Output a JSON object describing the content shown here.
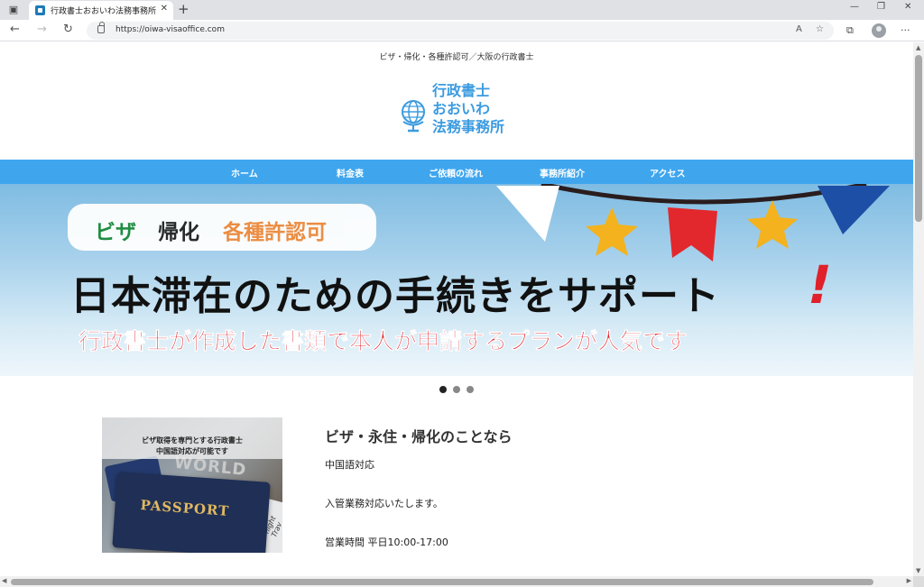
{
  "browser": {
    "tab_title": "行政書士おおいわ法務事務所",
    "url": "https://oiwa-visaoffice.com",
    "icons": {
      "window_menu": "window-icon",
      "new_tab": "plus-icon",
      "back": "back-arrow-icon",
      "forward": "forward-arrow-icon",
      "reload": "reload-icon",
      "lock": "lock-icon",
      "read_aloud": "read-aloud-icon",
      "favorites_add": "star-add-icon",
      "collections": "collections-icon",
      "profile": "profile-icon",
      "more": "more-icon"
    }
  },
  "site": {
    "tagline": "ビザ・帰化・各種許認可／大阪の行政書士",
    "logo_lines": [
      "行政書士",
      "おおいわ",
      "法務事務所"
    ],
    "logo_color": "#3b9be0",
    "nav": [
      "ホーム",
      "料金表",
      "ご依頼の流れ",
      "事務所紹介",
      "アクセス"
    ],
    "nav_color": "#3fa6ee"
  },
  "hero": {
    "pill_visa": "ビザ",
    "pill_naturalization": "帰化",
    "pill_permits": "各種許認可",
    "main_text": "日本滞在のための手続きをサポート",
    "exclamation": "!",
    "sub_text": "行政書士が作成した書類で本人が申請するプランが人気です",
    "carousel_dots": 3,
    "active_dot": 1
  },
  "feature_image": {
    "caption_line1": "ビザ取得を専門とする行政書士",
    "caption_line2": "中国語対応が可能です",
    "passport_text": "PASSPORT",
    "world_text": "WORLD",
    "card_text": "flight Trav"
  },
  "content": {
    "title": "ビザ・永住・帰化のことなら",
    "line1": "中国語対応",
    "line2": "入管業務対応いたします。",
    "line3": "営業時間 平日10:00-17:00"
  }
}
